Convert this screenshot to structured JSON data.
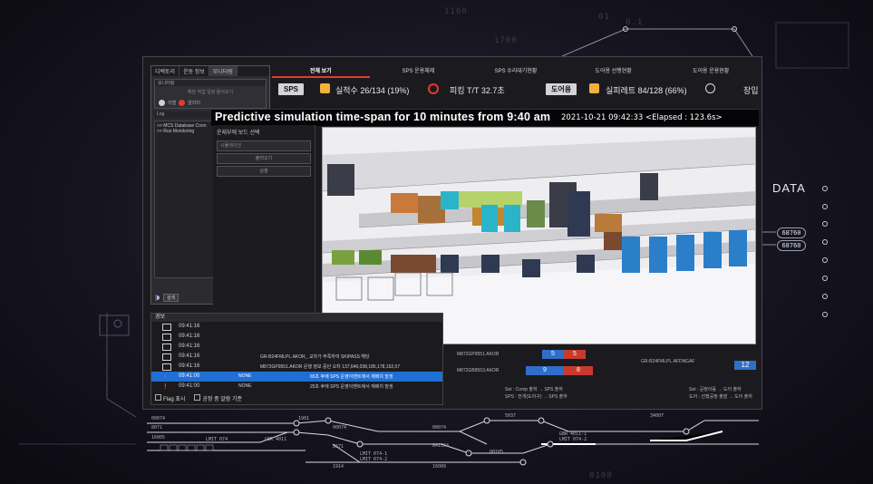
{
  "background": {
    "numbers": [
      "1100",
      "01",
      "1700",
      "0.1",
      "0108"
    ],
    "hud_title": "DATA",
    "hud_tags": [
      "68760",
      "68760"
    ]
  },
  "left_panel": {
    "tabs": [
      "디렉토리",
      "운동 정보",
      "모니터링"
    ],
    "section_title": "모니터링",
    "hint": "해당 작업 일정 들어오기",
    "status_items": [
      "라벨",
      "알리미"
    ],
    "log_header": "Log",
    "log_lines": [
      ">> MCS Database Conn",
      ">> Run Monitoring"
    ],
    "bottom_button": "검색"
  },
  "top_nav": {
    "tabs": [
      "전체 보기",
      "SPS 운용체제",
      "SPS 수리대기현황",
      "도어용 선행현황",
      "도어용 운용현황"
    ]
  },
  "status_bar": {
    "sps_label": "SPS",
    "progress_text": "실적수 26/134 (19%)",
    "tact_text": "피킹 T/T 32.7초",
    "door_label": "도어용",
    "door_progress_text": "실피레트 84/128 (66%)",
    "last_label": "장입"
  },
  "banner": {
    "title": "Predictive simulation time-span for 10 minutes from 9:40 am",
    "timestamp": "2021-10-21 09:42:33 <Elapsed : 123.6s>"
  },
  "sim_left": {
    "title": "운래부에 보드 선택",
    "field": "시뮬레이션",
    "btn1": "불러오기",
    "btn2": "실행"
  },
  "log_panel": {
    "title": "경보",
    "rows": [
      {
        "time": "09:41:16",
        "icon": "monitor",
        "code": "",
        "msg": ""
      },
      {
        "time": "09:41:16",
        "icon": "monitor",
        "code": "",
        "msg": ""
      },
      {
        "time": "09:41:16",
        "icon": "monitor",
        "code": "",
        "msg": ""
      },
      {
        "time": "09:41:16",
        "icon": "monitor",
        "code": "",
        "msg": "GR-B24FMLPL.AKOR_ 교차가 부족하여 SKIPASS 해당"
      },
      {
        "time": "09:41:16",
        "icon": "monitor",
        "code": "",
        "msg": "M872GP9551.AKOR  운행 정보 중단 오차 137,646,038,186,178,152,07"
      },
      {
        "time": "09:41:00",
        "icon": "alert",
        "code": "NONE",
        "msg": "65초 후에 SPS 운영이벤트에서 재배치 발생",
        "selected": true
      },
      {
        "time": "09:41:00",
        "icon": "alert",
        "code": "NONE",
        "msg": "25초 후에 SPS 운영이벤트에서 재배치 발생"
      }
    ],
    "footer_flag": "Flag 표시",
    "footer_other": "공정 중 알람 기준"
  },
  "sub_mid": {
    "code1": "M872GP9551.AKOR",
    "code2": "M872GB8553.AKOR",
    "bars": [
      {
        "left": "5",
        "right": "5"
      },
      {
        "left": "9",
        "right": "8"
      }
    ],
    "legend1": "Set : Comp 출하 → SPS 출하",
    "legend2": "SPS : 전개(도어구) → SPS 출하"
  },
  "sub_right": {
    "code": "GR-B24FMLPL.AFDNGAF",
    "value": "12",
    "legend1": "Set : 공정이동 → 도어 출하",
    "legend2": "도어 : 선행공정 출발 → 도어 출하"
  },
  "dashboard": {
    "labels": [
      "00074",
      "8071",
      "16005",
      "00074",
      "00074",
      "841504",
      "5037",
      "34007",
      "1901",
      "8671",
      "1914",
      "16089",
      "00105"
    ],
    "tiny_tags": [
      "LMIT 074",
      "GBR 4011",
      "LMIT 074-1",
      "GBR 4011-1",
      "LMIT 074-2",
      "LMIT 074-2"
    ]
  },
  "colors": {
    "accent_red": "#e63a2e",
    "select_blue": "#1f6fd6",
    "bar_blue": "#2f6fc9",
    "bar_red": "#c83a2d"
  }
}
